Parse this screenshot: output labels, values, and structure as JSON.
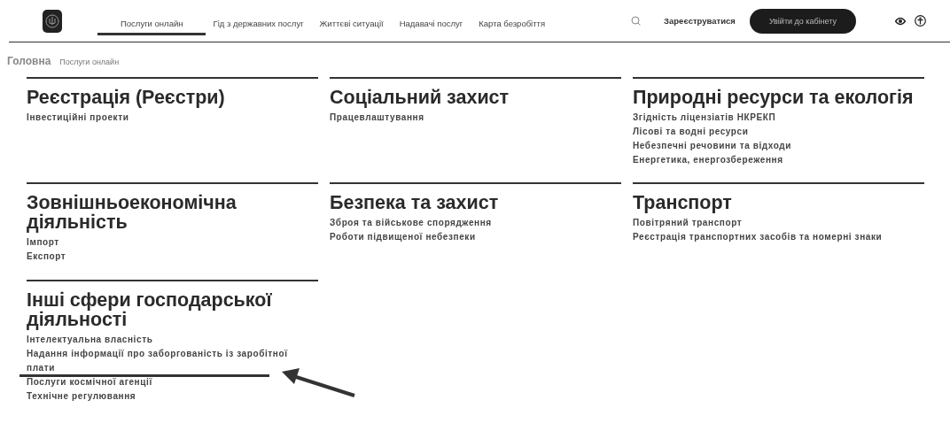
{
  "header": {
    "nav": [
      {
        "label": "Послуги онлайн",
        "selected": true
      },
      {
        "label": "Гід з державних послуг",
        "selected": false
      },
      {
        "label": "Життєві ситуації",
        "selected": false
      },
      {
        "label": "Надавачі послуг",
        "selected": false
      },
      {
        "label": "Карта безробіття",
        "selected": false
      }
    ],
    "register": "Зареєструватися",
    "login": "Увійти до кабінету"
  },
  "breadcrumbs": [
    "Головна",
    "Послуги онлайн"
  ],
  "sections": [
    {
      "title": "Реєстрація (Реєстри)",
      "links": [
        "Інвестиційні проекти"
      ]
    },
    {
      "title": "Соціальний захист",
      "links": [
        "Працевлаштування"
      ]
    },
    {
      "title": "Природні ресурси та екологія",
      "links": [
        "Згідність ліцензіатів НКРЕКП",
        "Лісові та водні ресурси",
        "Небезпечні речовини та відходи",
        "Енергетика, енергозбереження"
      ]
    },
    {
      "title": "Зовнішньоекономічна діяльність",
      "links": [
        "Імпорт",
        "Експорт"
      ]
    },
    {
      "title": "Безпека та захист",
      "links": [
        "Зброя та військове спорядження",
        "Роботи підвищеної небезпеки"
      ]
    },
    {
      "title": "Транспорт",
      "links": [
        "Повітряний транспорт",
        "Реєстрація транспортних засобів та номерні знаки"
      ]
    },
    {
      "title": "Інші сфери господарської діяльності",
      "links": [
        "Інтелектуальна власність",
        "Надання інформації про заборгованість із заробітної плати",
        "Послуги космічної агенції",
        "Технічне регулювання"
      ]
    }
  ]
}
